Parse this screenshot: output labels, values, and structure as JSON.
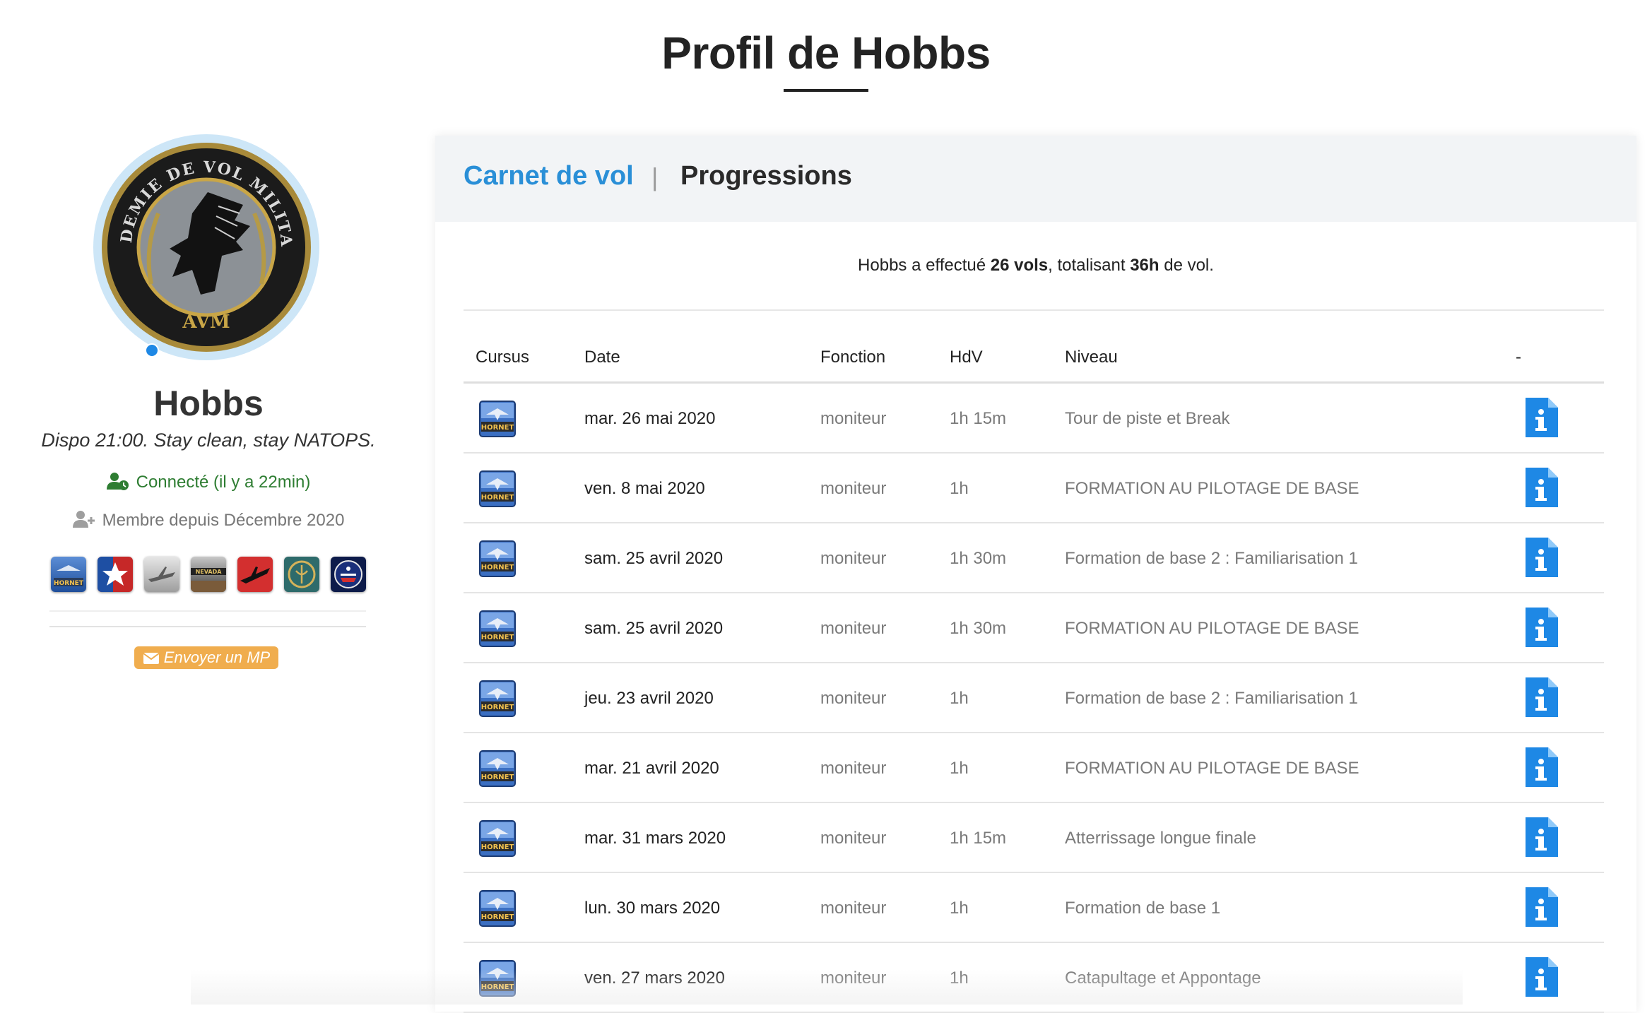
{
  "page": {
    "title": "Profil de Hobbs"
  },
  "profile": {
    "avatar_text_top": "ACADEMIE DE VOL MILITAIRE",
    "avatar_text_bottom": "AVM",
    "username": "Hobbs",
    "tagline": "Dispo 21:00. Stay clean, stay NATOPS.",
    "status": "Connecté (il y a 22min)",
    "member_since": "Membre depuis Décembre 2020",
    "badges": [
      {
        "icon": "hornet-badge-icon",
        "label": "HORNET"
      },
      {
        "icon": "star-badge-icon",
        "label": ""
      },
      {
        "icon": "warbird-badge-icon",
        "label": ""
      },
      {
        "icon": "nevada-badge-icon",
        "label": "NEVADA"
      },
      {
        "icon": "jet-badge-icon",
        "label": ""
      },
      {
        "icon": "emblem-badge-icon",
        "label": ""
      },
      {
        "icon": "us-seal-badge-icon",
        "label": ""
      }
    ],
    "send_mp_label": "Envoyer un MP"
  },
  "colors": {
    "accent_blue": "#2a8fd7",
    "status_green": "#2e7d32",
    "button_orange": "#f0ad4e",
    "info_icon_blue": "#1e88e5"
  },
  "tabs": [
    {
      "label": "Carnet de vol",
      "active": true
    },
    {
      "label": "Progressions",
      "active": false
    }
  ],
  "tab_separator": "|",
  "summary": {
    "prefix": "Hobbs a effectué ",
    "flights": "26 vols",
    "middle": ", totalisant ",
    "hours": "36h",
    "suffix": " de vol."
  },
  "table": {
    "headers": {
      "cursus": "Cursus",
      "date": "Date",
      "fonction": "Fonction",
      "hdv": "HdV",
      "niveau": "Niveau",
      "action": "-"
    },
    "rows": [
      {
        "cursus": "HORNET",
        "date": "mar. 26 mai 2020",
        "fonction": "moniteur",
        "hdv": "1h 15m",
        "niveau": "Tour de piste et Break"
      },
      {
        "cursus": "HORNET",
        "date": "ven. 8 mai 2020",
        "fonction": "moniteur",
        "hdv": "1h",
        "niveau": "FORMATION AU PILOTAGE DE BASE"
      },
      {
        "cursus": "HORNET",
        "date": "sam. 25 avril 2020",
        "fonction": "moniteur",
        "hdv": "1h 30m",
        "niveau": "Formation de base 2 : Familiarisation 1"
      },
      {
        "cursus": "HORNET",
        "date": "sam. 25 avril 2020",
        "fonction": "moniteur",
        "hdv": "1h 30m",
        "niveau": "FORMATION AU PILOTAGE DE BASE"
      },
      {
        "cursus": "HORNET",
        "date": "jeu. 23 avril 2020",
        "fonction": "moniteur",
        "hdv": "1h",
        "niveau": "Formation de base 2 : Familiarisation 1"
      },
      {
        "cursus": "HORNET",
        "date": "mar. 21 avril 2020",
        "fonction": "moniteur",
        "hdv": "1h",
        "niveau": "FORMATION AU PILOTAGE DE BASE"
      },
      {
        "cursus": "HORNET",
        "date": "mar. 31 mars 2020",
        "fonction": "moniteur",
        "hdv": "1h 15m",
        "niveau": "Atterrissage longue finale"
      },
      {
        "cursus": "HORNET",
        "date": "lun. 30 mars 2020",
        "fonction": "moniteur",
        "hdv": "1h",
        "niveau": "Formation de base 1"
      },
      {
        "cursus": "HORNET",
        "date": "ven. 27 mars 2020",
        "fonction": "moniteur",
        "hdv": "1h",
        "niveau": "Catapultage et Appontage"
      }
    ]
  }
}
